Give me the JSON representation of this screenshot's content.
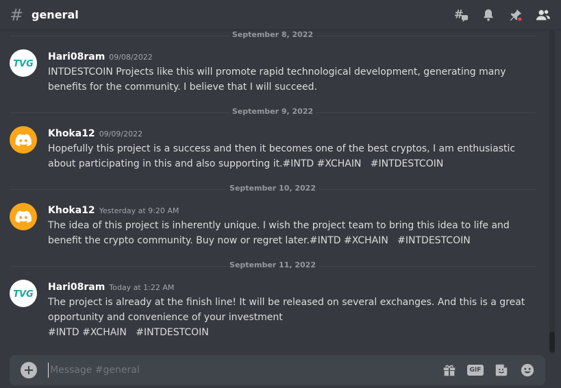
{
  "header": {
    "hash_glyph": "#",
    "channel": "general",
    "icons": [
      "threads-icon",
      "bell-icon",
      "pin-icon",
      "members-icon"
    ]
  },
  "messages": [
    {
      "date_divider": "September 8, 2022",
      "avatar": "tvg-avatar",
      "avatar_text": "TVG",
      "username": "Hari08ram",
      "timestamp": "09/08/2022",
      "lines": [
        "INTDESTCOIN Projects like this will promote rapid technological development, generating many",
        "benefits for the community. I believe that I will succeed."
      ]
    },
    {
      "date_divider": "September 9, 2022",
      "avatar": "discord-avatar",
      "username": "Khoka12",
      "timestamp": "09/09/2022",
      "lines": [
        "Hopefully this project is a success and then it becomes one of the best cryptos, I am enthusiastic",
        "about participating in this and also supporting it.#INTD #XCHAIN   #INTDESTCOIN"
      ]
    },
    {
      "date_divider": "September 10, 2022",
      "avatar": "discord-avatar",
      "username": "Khoka12",
      "timestamp": "Yesterday at 9:20 AM",
      "lines": [
        "The idea of this project is inherently unique. I wish the project team to bring this idea to life and",
        "benefit the crypto community. Buy now or regret later.#INTD #XCHAIN   #INTDESTCOIN"
      ]
    },
    {
      "date_divider": "September 11, 2022",
      "avatar": "tvg-avatar",
      "avatar_text": "TVG",
      "username": "Hari08ram",
      "timestamp": "Today at 1:22 AM",
      "lines": [
        "The project is already at the finish line! It will be released on several exchanges. And this is a great",
        "opportunity and convenience of your investment",
        "#INTD #XCHAIN   #INTDESTCOIN"
      ]
    }
  ],
  "composer": {
    "placeholder": "Message #general",
    "gif_label": "GIF"
  },
  "colors": {
    "background": "#36393f",
    "composer": "#40444b",
    "discord_avatar": "#faa61a",
    "tvg_teal": "#1aa7a0",
    "notification_dot": "#ed4245"
  }
}
